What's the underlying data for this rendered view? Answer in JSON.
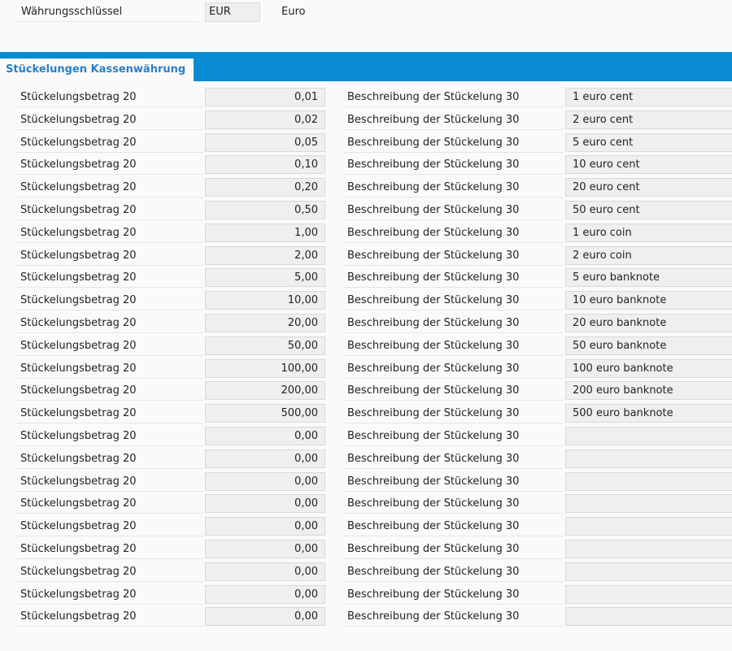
{
  "header": {
    "currency_key_label": "Währungsschlüssel",
    "currency_key_value": "EUR",
    "currency_name": "Euro"
  },
  "section": {
    "title": "Stückelungen Kassenwährung"
  },
  "rows": [
    {
      "amount_label": "Stückelungsbetrag 20",
      "amount": "0,01",
      "desc_label": "Beschreibung der Stückelung 30",
      "desc": "1 euro cent"
    },
    {
      "amount_label": "Stückelungsbetrag 20",
      "amount": "0,02",
      "desc_label": "Beschreibung der Stückelung 30",
      "desc": "2 euro cent"
    },
    {
      "amount_label": "Stückelungsbetrag 20",
      "amount": "0,05",
      "desc_label": "Beschreibung der Stückelung 30",
      "desc": "5 euro cent"
    },
    {
      "amount_label": "Stückelungsbetrag 20",
      "amount": "0,10",
      "desc_label": "Beschreibung der Stückelung 30",
      "desc": "10 euro cent"
    },
    {
      "amount_label": "Stückelungsbetrag 20",
      "amount": "0,20",
      "desc_label": "Beschreibung der Stückelung 30",
      "desc": "20 euro cent"
    },
    {
      "amount_label": "Stückelungsbetrag 20",
      "amount": "0,50",
      "desc_label": "Beschreibung der Stückelung 30",
      "desc": "50 euro cent"
    },
    {
      "amount_label": "Stückelungsbetrag 20",
      "amount": "1,00",
      "desc_label": "Beschreibung der Stückelung 30",
      "desc": "1 euro coin"
    },
    {
      "amount_label": "Stückelungsbetrag 20",
      "amount": "2,00",
      "desc_label": "Beschreibung der Stückelung 30",
      "desc": "2 euro coin"
    },
    {
      "amount_label": "Stückelungsbetrag 20",
      "amount": "5,00",
      "desc_label": "Beschreibung der Stückelung 30",
      "desc": "5 euro banknote"
    },
    {
      "amount_label": "Stückelungsbetrag 20",
      "amount": "10,00",
      "desc_label": "Beschreibung der Stückelung 30",
      "desc": "10 euro banknote"
    },
    {
      "amount_label": "Stückelungsbetrag 20",
      "amount": "20,00",
      "desc_label": "Beschreibung der Stückelung 30",
      "desc": "20 euro banknote"
    },
    {
      "amount_label": "Stückelungsbetrag 20",
      "amount": "50,00",
      "desc_label": "Beschreibung der Stückelung 30",
      "desc": "50 euro banknote"
    },
    {
      "amount_label": "Stückelungsbetrag 20",
      "amount": "100,00",
      "desc_label": "Beschreibung der Stückelung 30",
      "desc": "100 euro banknote"
    },
    {
      "amount_label": "Stückelungsbetrag 20",
      "amount": "200,00",
      "desc_label": "Beschreibung der Stückelung 30",
      "desc": "200 euro banknote"
    },
    {
      "amount_label": "Stückelungsbetrag 20",
      "amount": "500,00",
      "desc_label": "Beschreibung der Stückelung 30",
      "desc": "500 euro banknote"
    },
    {
      "amount_label": "Stückelungsbetrag 20",
      "amount": "0,00",
      "desc_label": "Beschreibung der Stückelung 30",
      "desc": ""
    },
    {
      "amount_label": "Stückelungsbetrag 20",
      "amount": "0,00",
      "desc_label": "Beschreibung der Stückelung 30",
      "desc": ""
    },
    {
      "amount_label": "Stückelungsbetrag 20",
      "amount": "0,00",
      "desc_label": "Beschreibung der Stückelung 30",
      "desc": ""
    },
    {
      "amount_label": "Stückelungsbetrag 20",
      "amount": "0,00",
      "desc_label": "Beschreibung der Stückelung 30",
      "desc": ""
    },
    {
      "amount_label": "Stückelungsbetrag 20",
      "amount": "0,00",
      "desc_label": "Beschreibung der Stückelung 30",
      "desc": ""
    },
    {
      "amount_label": "Stückelungsbetrag 20",
      "amount": "0,00",
      "desc_label": "Beschreibung der Stückelung 30",
      "desc": ""
    },
    {
      "amount_label": "Stückelungsbetrag 20",
      "amount": "0,00",
      "desc_label": "Beschreibung der Stückelung 30",
      "desc": ""
    },
    {
      "amount_label": "Stückelungsbetrag 20",
      "amount": "0,00",
      "desc_label": "Beschreibung der Stückelung 30",
      "desc": ""
    },
    {
      "amount_label": "Stückelungsbetrag 20",
      "amount": "0,00",
      "desc_label": "Beschreibung der Stückelung 30",
      "desc": ""
    }
  ]
}
